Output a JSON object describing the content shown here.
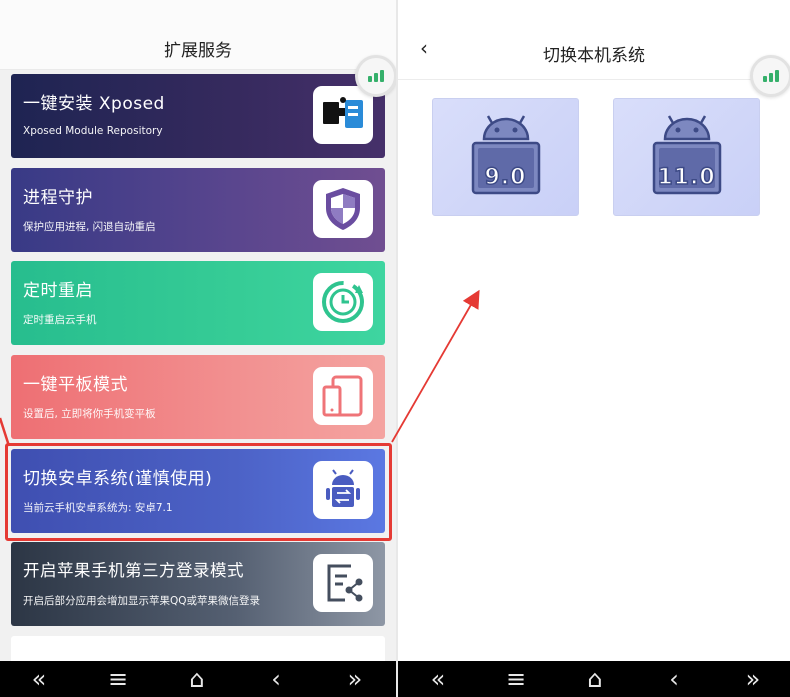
{
  "left": {
    "title": "扩展服务",
    "cards": [
      {
        "title": "一键安装 Xposed",
        "subtitle": "Xposed Module Repository",
        "icon": "puzzle-icon"
      },
      {
        "title": "进程守护",
        "subtitle": "保护应用进程, 闪退自动重启",
        "icon": "shield-icon"
      },
      {
        "title": "定时重启",
        "subtitle": "定时重启云手机",
        "icon": "clock-restart-icon"
      },
      {
        "title": "一键平板模式",
        "subtitle": "设置后, 立即将你手机变平板",
        "icon": "tablet-phone-icon"
      },
      {
        "title": "切换安卓系统(谨慎使用)",
        "subtitle": "当前云手机安卓系统为: 安卓7.1",
        "icon": "android-switch-icon"
      },
      {
        "title": "开启苹果手机第三方登录模式",
        "subtitle": "开启后部分应用会增加显示苹果QQ或苹果微信登录",
        "icon": "share-doc-icon"
      }
    ]
  },
  "right": {
    "title": "切换本机系统",
    "back_icon": "‹",
    "versions": [
      "9.0",
      "11.0"
    ]
  },
  "navbar": {
    "buttons": [
      "«",
      "≡",
      "⌂",
      "‹",
      "»"
    ]
  },
  "colors": {
    "highlight": "#e53a34",
    "signal": "#35b06b",
    "tile": "#d9defa"
  }
}
